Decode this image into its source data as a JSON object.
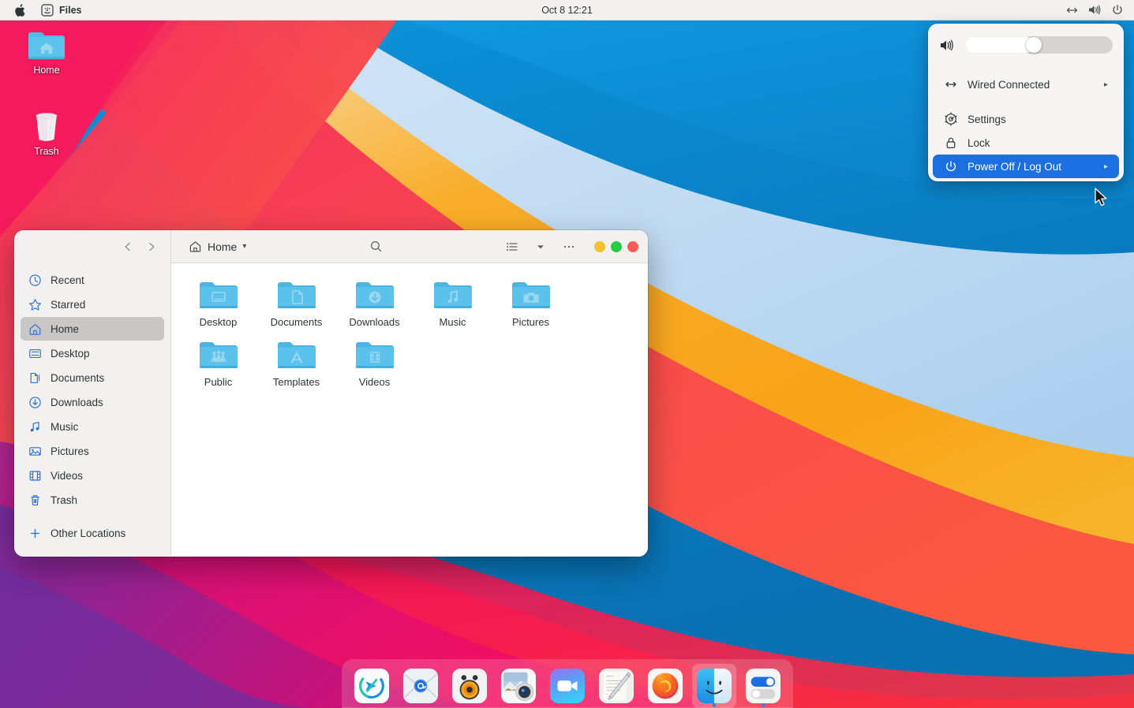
{
  "menubar": {
    "apple_logo": "apple-logo",
    "app_icon": "finder-face-icon",
    "app_name": "Files",
    "clock": "Oct 8  12:21",
    "right_icons": [
      {
        "name": "network-wired-icon",
        "label": "Wired network"
      },
      {
        "name": "volume-icon",
        "label": "Volume"
      },
      {
        "name": "power-icon",
        "label": "Power"
      }
    ]
  },
  "desktop": {
    "icons": [
      {
        "label": "Home",
        "icon": "home-folder-icon"
      },
      {
        "label": "Trash",
        "icon": "trash-bin-icon"
      }
    ]
  },
  "system_menu": {
    "volume": {
      "icon": "volume-high-icon",
      "value": 47
    },
    "rows": [
      {
        "label": "Wired Connected",
        "icon": "network-wired-icon",
        "arrow": "▸",
        "selected": false
      },
      {
        "label": "Settings",
        "icon": "gear-icon",
        "arrow": "",
        "selected": false
      },
      {
        "label": "Lock",
        "icon": "lock-icon",
        "arrow": "",
        "selected": false
      },
      {
        "label": "Power Off / Log Out",
        "icon": "power-icon",
        "arrow": "▸",
        "selected": true
      }
    ],
    "highlight_color": "#1b6fe0"
  },
  "file_manager": {
    "window_title": "Home",
    "path_label": "Home",
    "path_icon": "home-icon",
    "path_dropdown": "▾",
    "nav": {
      "back": "‹",
      "forward": "›"
    },
    "toolbar": {
      "search": "search-icon",
      "view_list": "list-view-icon",
      "view_dropdown": "▾",
      "menu": "⋯"
    },
    "window_controls": [
      {
        "name": "minimize-button",
        "color": "#f5c12e"
      },
      {
        "name": "maximize-button",
        "color": "#26cc42"
      },
      {
        "name": "close-button",
        "color": "#fc5b55"
      }
    ],
    "sidebar": [
      {
        "label": "Recent",
        "icon": "clock-icon",
        "active": false
      },
      {
        "label": "Starred",
        "icon": "star-icon",
        "active": false
      },
      {
        "label": "Home",
        "icon": "home-icon",
        "active": true
      },
      {
        "label": "Desktop",
        "icon": "desktop-icon",
        "active": false
      },
      {
        "label": "Documents",
        "icon": "documents-icon",
        "active": false
      },
      {
        "label": "Downloads",
        "icon": "download-icon",
        "active": false
      },
      {
        "label": "Music",
        "icon": "music-note-icon",
        "active": false
      },
      {
        "label": "Pictures",
        "icon": "picture-icon",
        "active": false
      },
      {
        "label": "Videos",
        "icon": "film-icon",
        "active": false
      },
      {
        "label": "Trash",
        "icon": "trash-icon",
        "active": false
      }
    ],
    "sidebar_footer": {
      "label": "Other Locations",
      "icon": "plus-icon"
    },
    "files": [
      {
        "label": "Desktop",
        "emblem": "desktop-emblem"
      },
      {
        "label": "Documents",
        "emblem": "document-emblem"
      },
      {
        "label": "Downloads",
        "emblem": "download-emblem"
      },
      {
        "label": "Music",
        "emblem": "music-emblem"
      },
      {
        "label": "Pictures",
        "emblem": "camera-emblem"
      },
      {
        "label": "Public",
        "emblem": "people-emblem"
      },
      {
        "label": "Templates",
        "emblem": "template-emblem"
      },
      {
        "label": "Videos",
        "emblem": "video-emblem"
      }
    ]
  },
  "dock": {
    "items": [
      {
        "name": "dock-item-xpra",
        "label": "Remote Desktop",
        "icon": "compass-arrow-icon",
        "running": false
      },
      {
        "name": "dock-item-mail",
        "label": "Mail",
        "icon": "envelope-icon",
        "running": false
      },
      {
        "name": "dock-item-audio",
        "label": "Audio Recorder",
        "icon": "speaker-icon",
        "running": false
      },
      {
        "name": "dock-item-photos",
        "label": "Photos",
        "icon": "camera-photo-icon",
        "running": false
      },
      {
        "name": "dock-item-facetime",
        "label": "Video Call",
        "icon": "video-camera-icon",
        "running": false
      },
      {
        "name": "dock-item-notes",
        "label": "Notes",
        "icon": "notepad-pen-icon",
        "running": false
      },
      {
        "name": "dock-item-firefox",
        "label": "Firefox",
        "icon": "firefox-icon",
        "running": false
      },
      {
        "name": "dock-item-finder",
        "label": "Files",
        "icon": "finder-face-icon",
        "running": true
      },
      {
        "name": "dock-item-settings",
        "label": "Settings",
        "icon": "toggles-icon",
        "running": true
      }
    ]
  },
  "wallpaper": {
    "style": "big-sur-waves",
    "colors": {
      "sky_top": "#0f8fd6",
      "sky_deep": "#0a7ec4",
      "sky_pale": "#bcd9f2",
      "sand": "#f5a623",
      "coral": "#f9484f",
      "pink": "#f5136a",
      "magenta": "#c2157f",
      "purple": "#7c2f9e"
    }
  }
}
